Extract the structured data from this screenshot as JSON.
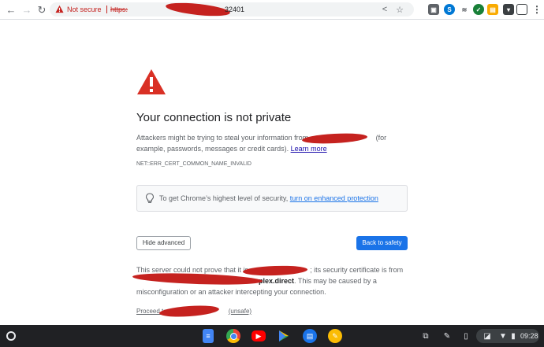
{
  "browser": {
    "security_label": "Not secure",
    "url_visible_prefix": "https:",
    "url_visible_suffix": "32401",
    "icons": [
      "back-icon",
      "forward-icon",
      "reload-icon",
      "share-icon",
      "bookmark-star-icon"
    ],
    "extensions": [
      "capture-extension",
      "skype-extension",
      "wave-extension",
      "green-extension",
      "lock-extension",
      "shield-extension",
      "panel-icon",
      "menu-icon"
    ]
  },
  "page": {
    "heading": "Your connection is not private",
    "para1_before": "Attackers might be trying to steal your information from",
    "para1_after": " (for example, passwords, messages or credit cards).",
    "learn_more": "Learn more",
    "error_code": "NET::ERR_CERT_COMMON_NAME_INVALID",
    "promo_text": "To get Chrome’s highest level of security, ",
    "promo_link": "turn on enhanced protection",
    "hide_advanced": "Hide advanced",
    "back_to_safety": "Back to safety",
    "para2_a": "This server could not prove that it is",
    "para2_b": "; its security certificate is from",
    "para2_host": "plex.direct",
    "para2_c": ". This may be caused by a misconfiguration or an attacker intercepting your connection.",
    "proceed_prefix": "Proceed to",
    "proceed_suffix": "(unsafe)"
  },
  "shelf": {
    "apps": [
      "docs",
      "chrome",
      "youtube",
      "play-store",
      "messages",
      "keep"
    ],
    "time": "09:28"
  },
  "colors": {
    "warning_red": "#d93025",
    "redaction": "#c5221f",
    "link_blue": "#1a73e8",
    "shelf_bg": "#202124"
  }
}
